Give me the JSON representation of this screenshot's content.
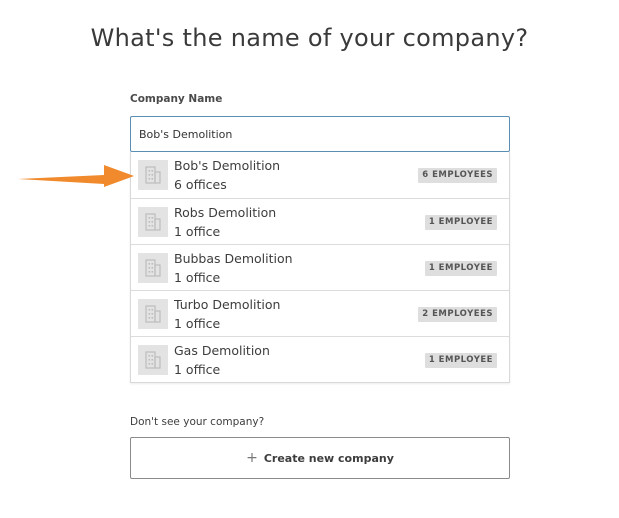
{
  "page": {
    "title": "What's the name of your company?"
  },
  "company_field": {
    "label": "Company Name",
    "value": "Bob's Demolition"
  },
  "results": [
    {
      "name": "Bob's Demolition",
      "offices": "6 offices",
      "employees": "6 EMPLOYEES"
    },
    {
      "name": "Robs Demolition",
      "offices": "1 office",
      "employees": "1 EMPLOYEE"
    },
    {
      "name": "Bubbas Demolition",
      "offices": "1 office",
      "employees": "1 EMPLOYEE"
    },
    {
      "name": "Turbo Demolition",
      "offices": "1 office",
      "employees": "2 EMPLOYEES"
    },
    {
      "name": "Gas Demolition",
      "offices": "1 office",
      "employees": "1 EMPLOYEE"
    }
  ],
  "icons": {
    "result_icon": "building-icon",
    "annotation": "arrow-icon",
    "create": "plus-icon"
  },
  "footer": {
    "prompt": "Don't see your company?",
    "create_icon_glyph": "+",
    "create_label": "Create new company"
  },
  "colors": {
    "input_border": "#5a8fb3",
    "arrow": "#f08a2c",
    "badge_bg": "#dedede",
    "icon_bg": "#e3e3e3"
  }
}
